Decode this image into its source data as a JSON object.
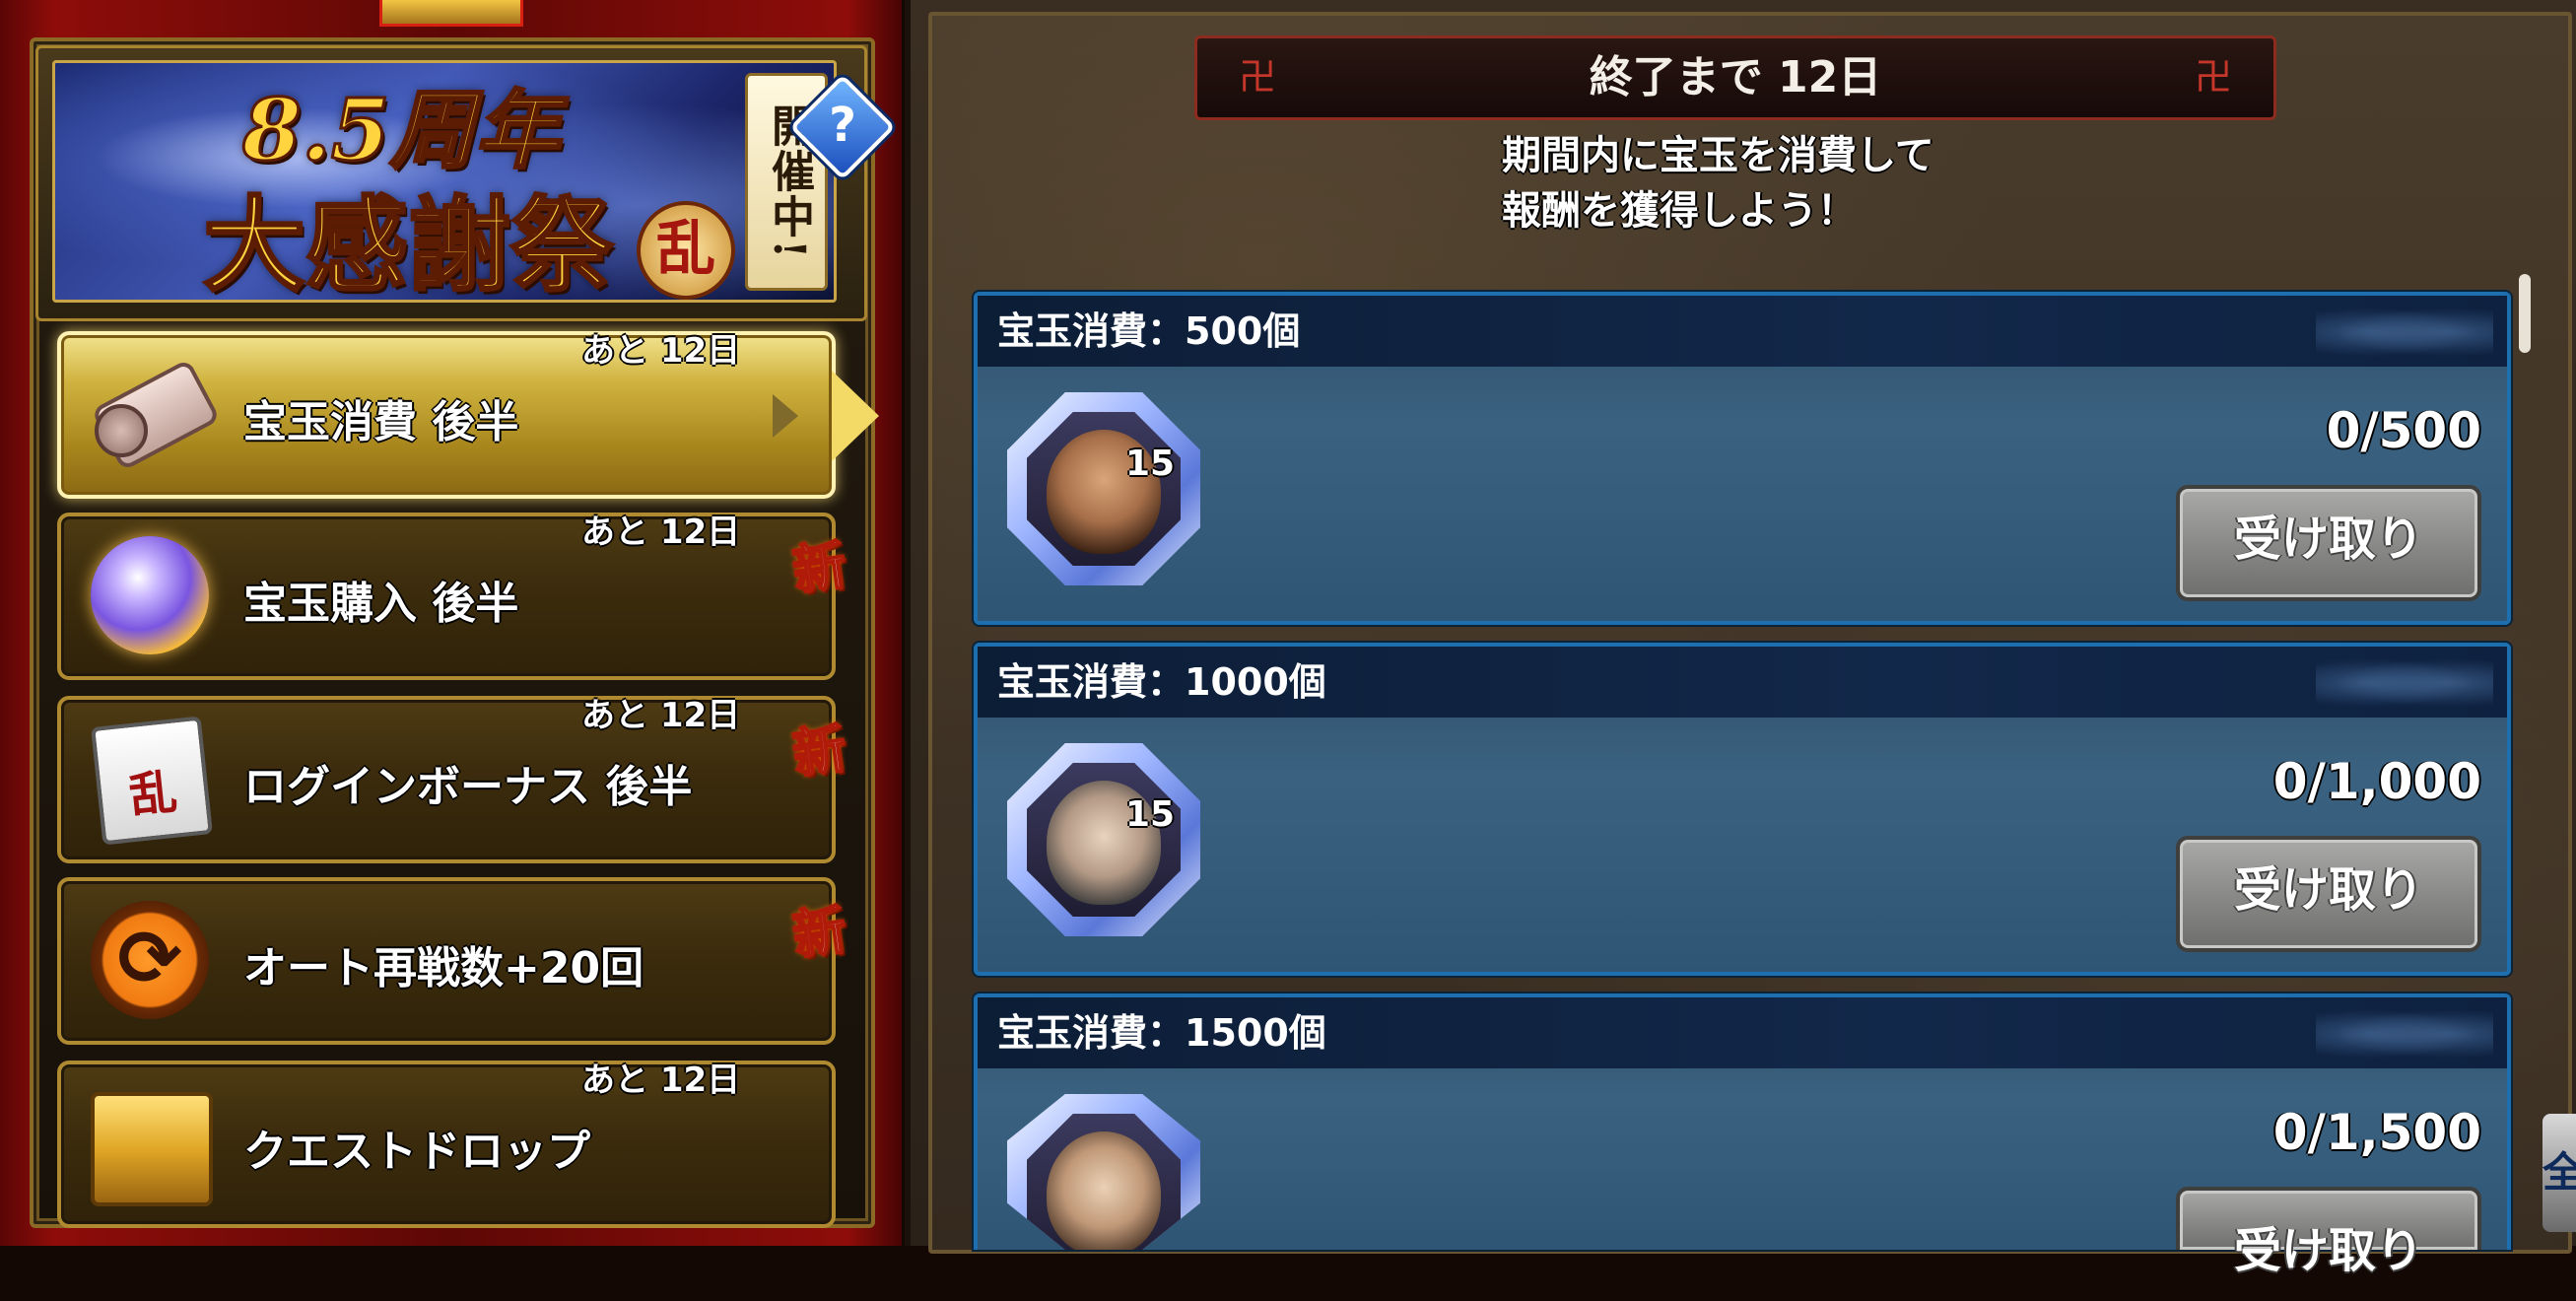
{
  "banner": {
    "anniversary": "8.5周年",
    "festival": "大感謝祭",
    "badge": "乱",
    "status": "開催中!"
  },
  "menu": [
    {
      "label": "宝玉消費 後半",
      "remaining": "あと 12日",
      "icon": "scroll-icon",
      "selected": true,
      "new": false
    },
    {
      "label": "宝玉購入 後半",
      "remaining": "あと 12日",
      "icon": "orb-icon",
      "selected": false,
      "new": true
    },
    {
      "label": "ログインボーナス 後半",
      "remaining": "あと 12日",
      "icon": "calendar-icon",
      "selected": false,
      "new": true
    },
    {
      "label": "オート再戦数+20回",
      "remaining": "",
      "icon": "repeat-icon",
      "selected": false,
      "new": true
    },
    {
      "label": "クエストドロップ",
      "remaining": "あと 12日",
      "icon": "chest-icon",
      "selected": false,
      "new": false
    }
  ],
  "new_badge": "新",
  "calendar_glyph": "乱",
  "deadline": "終了まで 12日",
  "description": [
    "期間内に宝玉を消費して",
    "報酬を獲得しよう！"
  ],
  "missions": [
    {
      "title": "宝玉消費：500個",
      "progress": "0/500",
      "reward_qty": "15",
      "button": "受け取り"
    },
    {
      "title": "宝玉消費：1000個",
      "progress": "0/1,000",
      "reward_qty": "15",
      "button": "受け取り"
    },
    {
      "title": "宝玉消費：1500個",
      "progress": "0/1,500",
      "reward_qty": "",
      "button": "受け取り"
    }
  ],
  "side_badge": "全",
  "colors": {
    "left_bg": "#8e0d0a",
    "gold": "#b08a30",
    "card_border": "#1e6fb0",
    "card_header": "#0c1d36",
    "deadline_border": "#8d2c1e"
  }
}
